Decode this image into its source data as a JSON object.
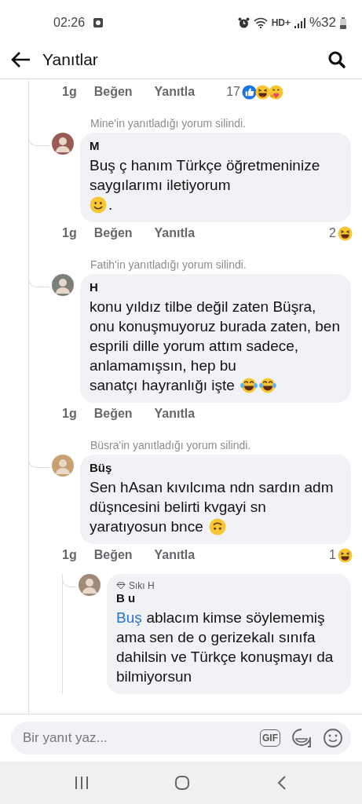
{
  "status_bar": {
    "time": "02:26",
    "network": "HD+",
    "battery": "%32"
  },
  "header": {
    "title": "Yanıtlar"
  },
  "top_actions": {
    "time": "1g",
    "like": "Beğen",
    "reply": "Yanıtla",
    "reaction_count": "17",
    "reactions": [
      {
        "kind": "like"
      },
      {
        "kind": "haha"
      },
      {
        "kind": "care"
      }
    ]
  },
  "comments": [
    {
      "nested": false,
      "deleted_notice": "Mine'in yanıtladığı yorum silindi.",
      "author": "M",
      "text": "Buş ç hanım Türkçe öğretmeninize saygılarımı iletiyorum",
      "last_line": [
        {
          "kind": "smile"
        },
        {
          "kind": "text",
          "text": "."
        }
      ],
      "actions": {
        "time": "1g",
        "like": "Beğen",
        "reply": "Yanıtla",
        "reaction_count": "2",
        "reactions": [
          {
            "kind": "haha"
          }
        ]
      }
    },
    {
      "nested": false,
      "deleted_notice": "Fatih'in yanıtladığı yorum silindi.",
      "author": "H",
      "text": "konu yıldız tilbe değil zaten Büşra, onu konuşmuyoruz burada zaten, ben esprili dille yorum attım sadece, anlamamışsın, hep bu",
      "last_line": [
        {
          "kind": "text",
          "text": "sanatçı hayranlığı işte"
        },
        {
          "kind": "tears"
        },
        {
          "kind": "tears"
        }
      ],
      "actions": {
        "time": "1g",
        "like": "Beğen",
        "reply": "Yanıtla"
      }
    },
    {
      "nested": false,
      "deleted_notice": "Büsra'in yanıtladığı yorum silindi.",
      "author": "Büş",
      "text": "Sen hAsan kıvılcıma ndn sardın adm düşncesini belirti kvgayi sn",
      "last_line": [
        {
          "kind": "text",
          "text": "yaratıyosun bnce"
        },
        {
          "kind": "upside"
        }
      ],
      "actions": {
        "time": "1g",
        "like": "Beğen",
        "reply": "Yanıtla",
        "reaction_count": "1",
        "reactions": [
          {
            "kind": "haha"
          }
        ]
      }
    },
    {
      "nested": true,
      "badge": "Sıkı H",
      "author": "B u",
      "mention": "Buş",
      "text": "ablacım kimse söylememiş ama sen de o gerizekalı sınıfa dahilsin ve Türkçe konuşmayı da bilmiyorsun"
    }
  ],
  "composer": {
    "placeholder": "Bir yanıt yaz...",
    "gif_label": "GIF"
  }
}
